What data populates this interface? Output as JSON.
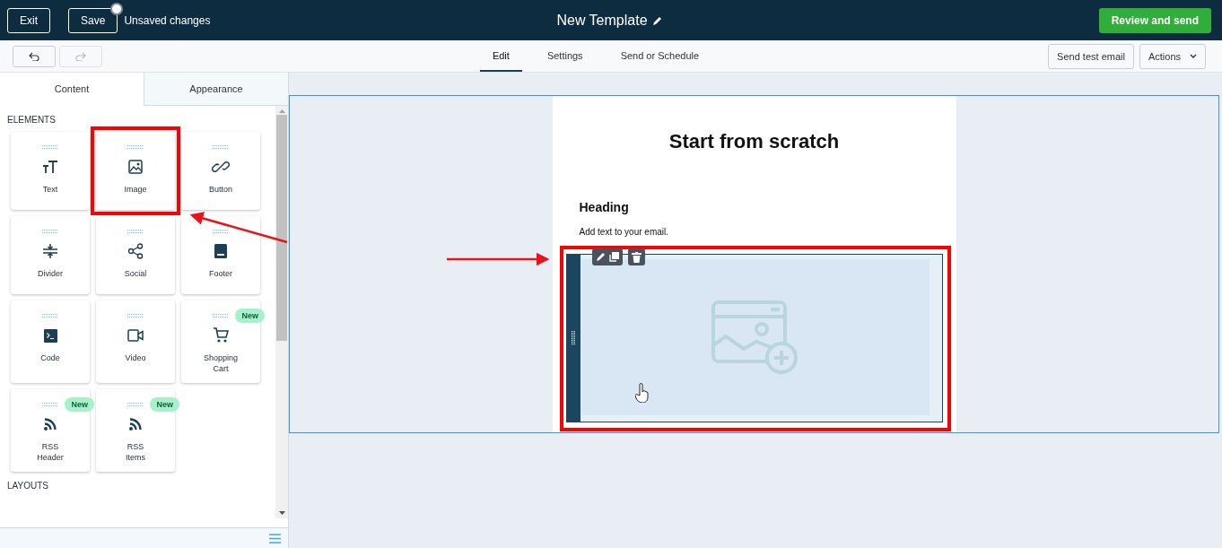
{
  "header": {
    "buttons": [
      "Exit",
      "Save"
    ],
    "unsaved": true,
    "status": "Unsaved changes",
    "title": "New Template",
    "primary_button": "Review and send"
  },
  "toolbar": {
    "redo_disabled": true,
    "tabs": [
      {
        "label": "Edit",
        "selected": true
      },
      {
        "label": "Settings",
        "selected": false
      },
      {
        "label": "Send or Schedule",
        "selected": false
      }
    ],
    "button": "Send test email",
    "menu": "Actions"
  },
  "panel": {
    "tabs": [
      {
        "label": "Content",
        "selected": true
      },
      {
        "label": "Appearance",
        "selected": false
      }
    ],
    "elements_title": "ELEMENTS",
    "elements": [
      {
        "label": "Text",
        "kind": "text",
        "highlighted": false
      },
      {
        "label": "Image",
        "kind": "image",
        "highlighted": true
      },
      {
        "label": "Button",
        "kind": "button",
        "highlighted": false
      },
      {
        "label": "Divider",
        "kind": "divider",
        "highlighted": false
      },
      {
        "label": "Social",
        "kind": "social",
        "highlighted": false
      },
      {
        "label": "Footer",
        "kind": "footer",
        "highlighted": false
      },
      {
        "label": "Code",
        "kind": "code",
        "highlighted": false
      },
      {
        "label": "Video",
        "kind": "video",
        "highlighted": false
      },
      {
        "label": "Shopping Cart",
        "kind": "cart",
        "badge": "New",
        "highlighted": false
      },
      {
        "label": "RSS Header",
        "kind": "rss",
        "badge": "New",
        "highlighted": false
      },
      {
        "label": "RSS Items",
        "kind": "rss",
        "badge": "New",
        "highlighted": false
      }
    ],
    "layouts_title": "LAYOUTS"
  },
  "email": {
    "title": "Start from scratch",
    "heading": "Heading",
    "body": "Add text to your email.",
    "image_block": {
      "highlighted": true
    }
  }
}
